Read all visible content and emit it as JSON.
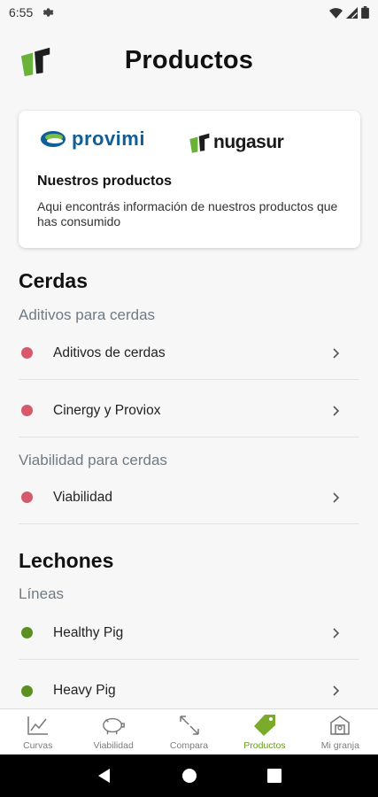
{
  "status_bar": {
    "time": "6:55"
  },
  "header": {
    "title": "Productos"
  },
  "brand_card": {
    "provimi": "provimi",
    "nugasur": "nugasur",
    "title": "Nuestros productos",
    "description": "Aqui encontrás información de nuestros productos que has consumido"
  },
  "sections": [
    {
      "title": "Cerdas",
      "groups": [
        {
          "subtitle": "Aditivos para cerdas",
          "items": [
            "Aditivos de cerdas",
            "Cinergy y Proviox"
          ]
        },
        {
          "subtitle": "Viabilidad para cerdas",
          "items": [
            "Viabilidad"
          ]
        }
      ]
    },
    {
      "title": "Lechones",
      "groups": [
        {
          "subtitle": "Líneas",
          "items": [
            "Healthy Pig",
            "Heavy Pig"
          ]
        }
      ]
    }
  ],
  "bottom_nav": [
    {
      "label": "Curvas",
      "icon": "chart-icon"
    },
    {
      "label": "Viabilidad",
      "icon": "pig-icon"
    },
    {
      "label": "Compara",
      "icon": "compare-arrows-icon"
    },
    {
      "label": "Productos",
      "icon": "tag-icon",
      "active": true
    },
    {
      "label": "Mi granja",
      "icon": "farm-icon"
    }
  ],
  "colors": {
    "cerdas_dot": "#d65a6e",
    "lechones_dot": "#5b8f22",
    "active_nav": "#6a9a22",
    "logo_green": "#6bb23a",
    "provimi_blue": "#0f5e96"
  }
}
